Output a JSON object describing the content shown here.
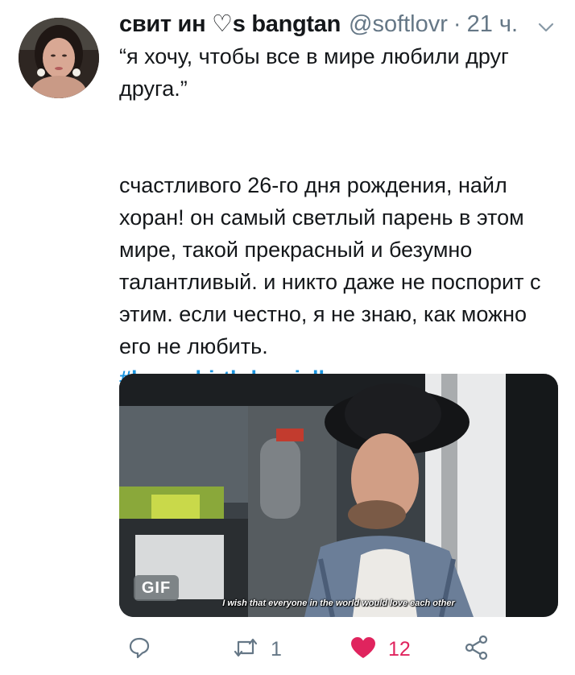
{
  "tweet": {
    "display_name": "свит ин ♡s bangtan",
    "handle": "@softlovr",
    "separator": "·",
    "time": "21 ч.",
    "text_quote": "“я хочу, чтобы все в мире любили друг друга.”",
    "text_body": "счастливого 26-го дня рождения, найл хоран! он самый светлый парень в этом мире, такой прекрасный и безумно талантливый. и никто даже не поспорит с этим. если честно, я не знаю, как можно его не любить.",
    "hashtag": "#happybirthdayniall"
  },
  "media": {
    "badge": "GIF",
    "subtitle": "I wish that everyone in the world would love each other"
  },
  "actions": {
    "reply_icon": "reply-icon",
    "retweet_icon": "retweet-icon",
    "retweet_count": "1",
    "like_icon": "heart-icon",
    "like_count": "12",
    "share_icon": "share-icon"
  },
  "colors": {
    "link": "#1b95e0",
    "like": "#e0245e",
    "muted": "#657786",
    "text": "#14171a"
  }
}
